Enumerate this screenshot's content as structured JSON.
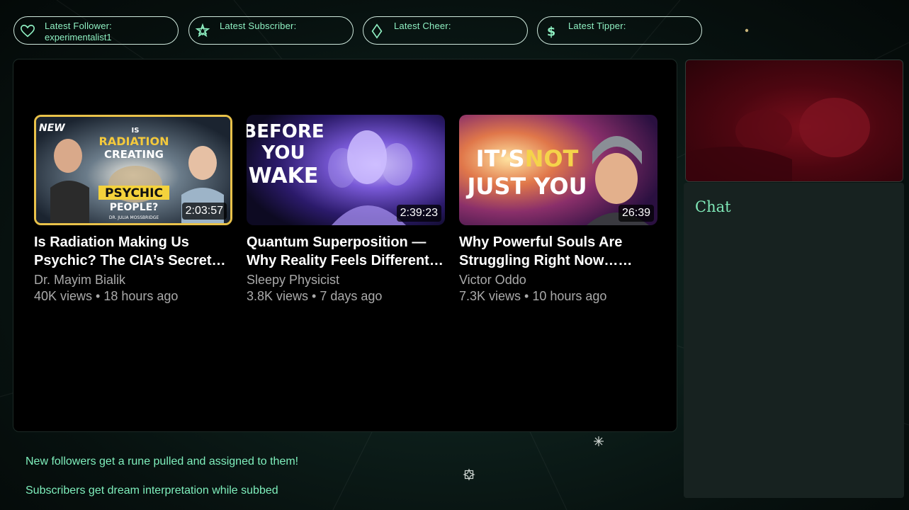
{
  "alerts": [
    {
      "label": "Latest Follower:",
      "value": "experimentalist1",
      "icon": "heart-icon"
    },
    {
      "label": "Latest Subscriber:",
      "value": "",
      "icon": "star-icon"
    },
    {
      "label": "Latest Cheer:",
      "value": "",
      "icon": "diamond-icon"
    },
    {
      "label": "Latest Tipper:",
      "value": "",
      "icon": "dollar-icon"
    }
  ],
  "videos": [
    {
      "title": "Is Radiation Making Us Psychic? The CIA’s Secret…",
      "channel": "Dr. Mayim Bialik",
      "meta": "40K views • 18 hours ago",
      "duration": "2:03:57",
      "thumb_text": {
        "badge": "NEW",
        "line1": "IS",
        "line2": "RADIATION",
        "line3": "CREATING",
        "line4": "PSYCHIC",
        "line5": "PEOPLE?",
        "credit": "DR. JULIA MOSSBRIDGE"
      }
    },
    {
      "title": "Quantum Superposition — Why Reality Feels Different…",
      "channel": "Sleepy Physicist",
      "meta": "3.8K views • 7 days ago",
      "duration": "2:39:23",
      "thumb_text": {
        "line1": "BEFORE",
        "line2": "YOU",
        "line3": "WAKE"
      }
    },
    {
      "title": "Why Powerful Souls Are Struggling Right Now……",
      "channel": "Victor Oddo",
      "meta": "7.3K views • 10 hours ago",
      "duration": "26:39",
      "thumb_text": {
        "line1a": "IT’S",
        "line1b": "NOT",
        "line2": "JUST YOU"
      }
    }
  ],
  "chat": {
    "title": "Chat"
  },
  "perks": [
    "New followers get a rune pulled and assigned to them!",
    "Subscribers get dream interpretation while subbed"
  ],
  "colors": {
    "accent": "#8ff0c2",
    "panel": "#000000",
    "chat_bg": "#172220"
  }
}
